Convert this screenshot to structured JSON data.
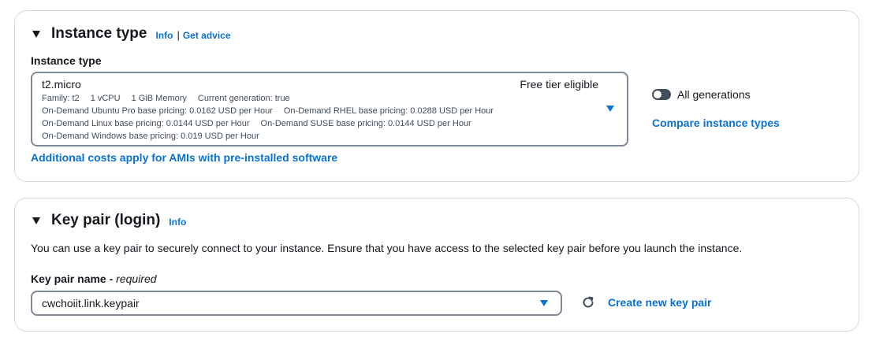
{
  "instance_type": {
    "title": "Instance type",
    "info": "Info",
    "separator": "|",
    "get_advice": "Get advice",
    "field_label": "Instance type",
    "selected": {
      "name": "t2.micro",
      "tag": "Free tier eligible",
      "line1": [
        "Family: t2",
        "1 vCPU",
        "1 GiB Memory",
        "Current generation: true"
      ],
      "line2": [
        "On-Demand Ubuntu Pro base pricing: 0.0162 USD per Hour",
        "On-Demand RHEL base pricing: 0.0288 USD per Hour"
      ],
      "line3": [
        "On-Demand Linux base pricing: 0.0144 USD per Hour",
        "On-Demand SUSE base pricing: 0.0144 USD per Hour"
      ],
      "line4": [
        "On-Demand Windows base pricing: 0.019 USD per Hour"
      ]
    },
    "all_generations_label": "All generations",
    "all_generations_on": false,
    "compare_link": "Compare instance types",
    "additional_costs_link": "Additional costs apply for AMIs with pre-installed software"
  },
  "key_pair": {
    "title": "Key pair (login)",
    "info": "Info",
    "description": "You can use a key pair to securely connect to your instance. Ensure that you have access to the selected key pair before you launch the instance.",
    "field_label": "Key pair name",
    "field_required": "required",
    "selected": "cwchoiit.link.keypair",
    "create_link": "Create new key pair"
  },
  "colors": {
    "accent": "#0972d3",
    "text": "#16191f",
    "border": "#7d8998"
  },
  "icons": {
    "expand": "caret-down-icon",
    "dropdown": "triangle-down-icon",
    "refresh": "refresh-icon"
  }
}
